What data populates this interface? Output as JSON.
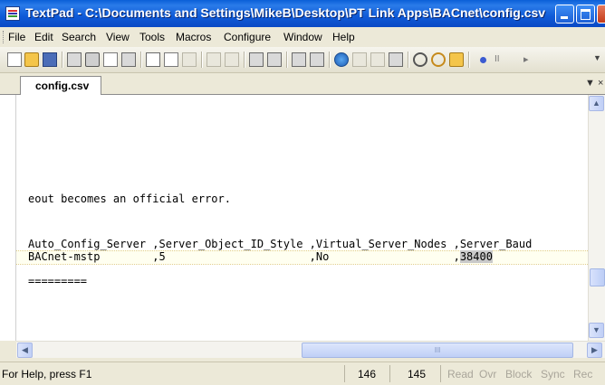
{
  "window": {
    "title": "TextPad - C:\\Documents and Settings\\MikeB\\Desktop\\PT Link Apps\\BACnet\\config.csv"
  },
  "menu": {
    "items": [
      {
        "label": "File",
        "key": "F"
      },
      {
        "label": "Edit",
        "key": "E"
      },
      {
        "label": "Search",
        "key": "S"
      },
      {
        "label": "View",
        "key": "V"
      },
      {
        "label": "Tools",
        "key": "T"
      },
      {
        "label": "Macros",
        "key": "M"
      },
      {
        "label": "Configure",
        "key": "C"
      },
      {
        "label": "Window",
        "key": "W"
      },
      {
        "label": "Help",
        "key": "H"
      }
    ]
  },
  "toolbar": {
    "icons": [
      "new-icon",
      "open-icon",
      "save-icon",
      "save-all-icon",
      "print-icon",
      "print-preview-icon",
      "page-setup-icon",
      "cut-icon",
      "copy-icon",
      "paste-icon",
      "undo-icon",
      "redo-icon",
      "indent-icon",
      "outdent-icon",
      "word-wrap-icon",
      "pilcrow-icon",
      "browser-icon",
      "spell-check-icon",
      "sort-icon",
      "compare-icon",
      "find-icon",
      "replace-icon",
      "find-in-files-icon",
      "record-macro-icon",
      "play-macro-icon"
    ],
    "extra_glyph": "II"
  },
  "tabs": [
    {
      "label": "config.csv",
      "active": true
    }
  ],
  "editor": {
    "lines": [
      {
        "text": "eout becomes an official error."
      },
      {
        "text": "Auto_Config_Server ,Server_Object_ID_Style ,Virtual_Server_Nodes ,Server_Baud"
      },
      {
        "text_before": "BACnet-mstp        ,5                      ,No                   ,",
        "selected": "38400"
      },
      {
        "text": "========="
      }
    ]
  },
  "statusbar": {
    "help": "For Help, press F1",
    "line": "146",
    "column": "145",
    "read": "Read",
    "ovr": "Ovr",
    "block": "Block",
    "sync": "Sync",
    "rec": "Rec"
  },
  "colors": {
    "titlebar": "#0a5fd8",
    "close_button": "#c43b19",
    "editor_background": "#ffffff",
    "current_line_band": "#fffff0",
    "selection": "#c9c9c9"
  }
}
